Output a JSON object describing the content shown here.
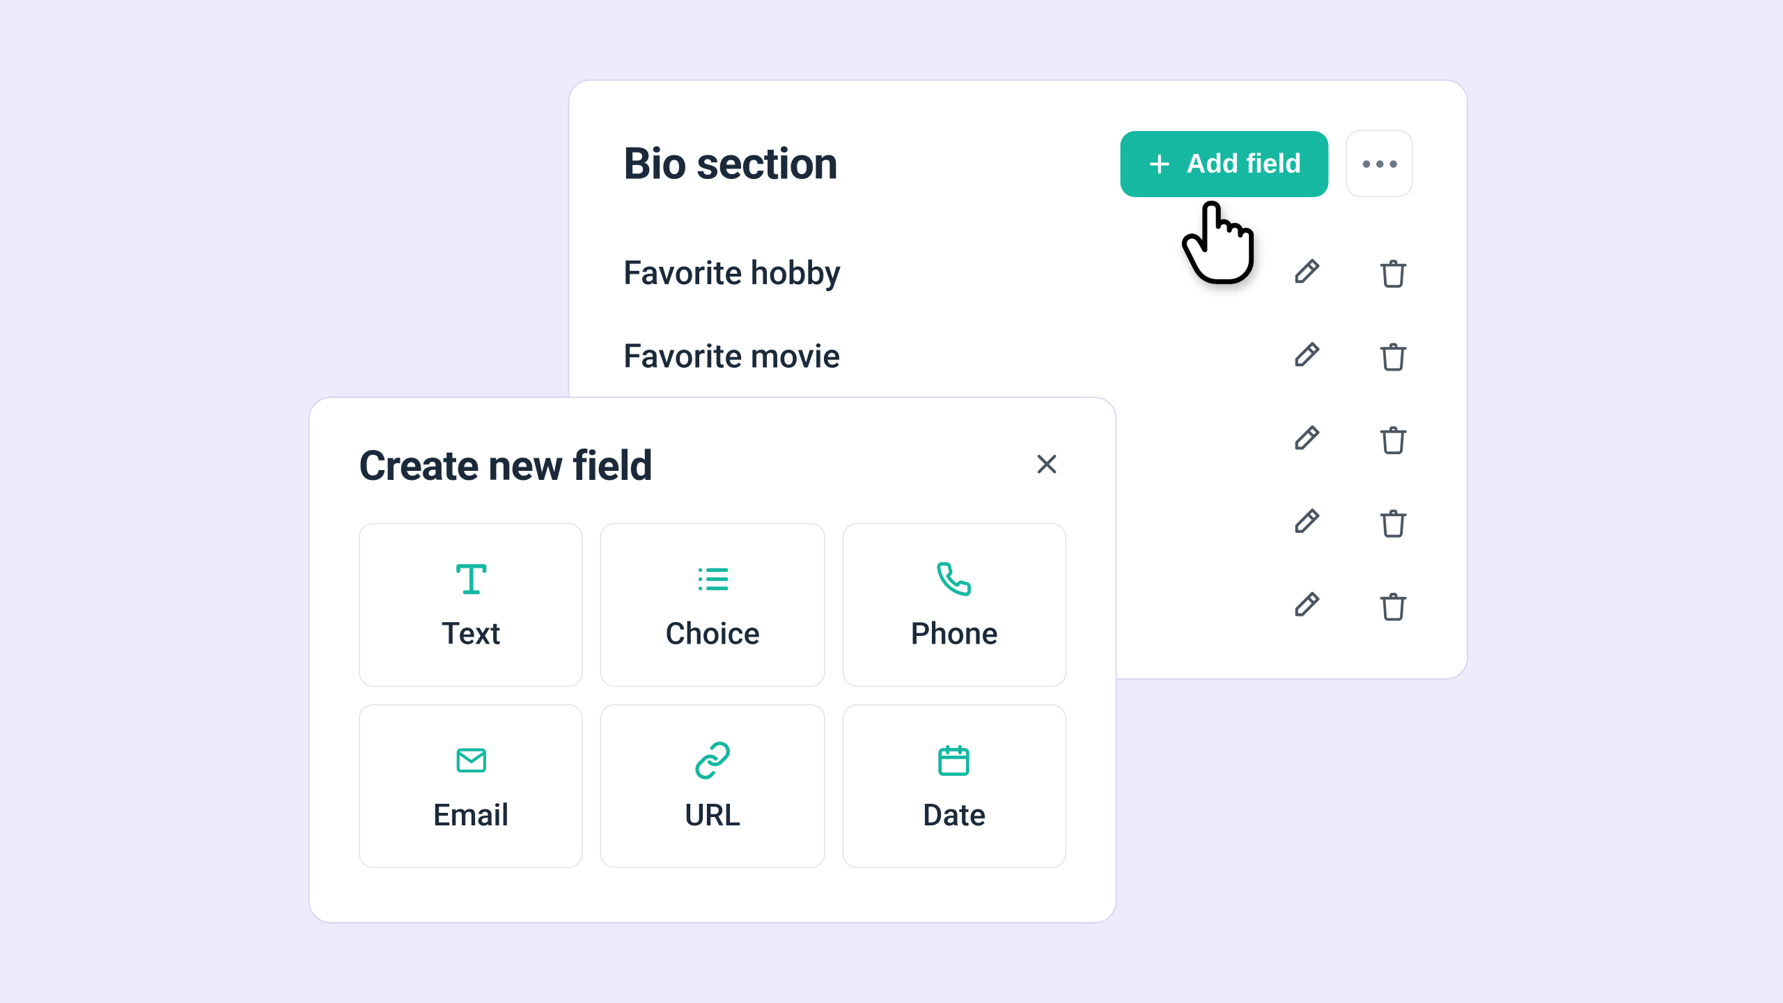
{
  "bio": {
    "title": "Bio section",
    "add_field_label": "Add field",
    "fields": [
      {
        "label": "Favorite hobby"
      },
      {
        "label": "Favorite movie"
      },
      {
        "label": ""
      },
      {
        "label": ""
      },
      {
        "label": ""
      }
    ]
  },
  "modal": {
    "title": "Create new field",
    "types": [
      {
        "key": "text",
        "label": "Text"
      },
      {
        "key": "choice",
        "label": "Choice"
      },
      {
        "key": "phone",
        "label": "Phone"
      },
      {
        "key": "email",
        "label": "Email"
      },
      {
        "key": "url",
        "label": "URL"
      },
      {
        "key": "date",
        "label": "Date"
      }
    ]
  },
  "colors": {
    "accent": "#16B8A2",
    "border": "#D7D3F4",
    "card_border": "#E3E6EA",
    "text": "#1B2A3A",
    "muted_icon": "#4A5662",
    "background": "#ECEBFA"
  }
}
